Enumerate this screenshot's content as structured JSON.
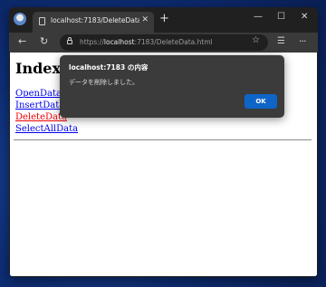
{
  "browser": {
    "tab_title": "localhost:7183/DeleteData.html",
    "url_prefix": "https://",
    "url_host": "localhost",
    "url_rest": ":7183/DeleteData.html"
  },
  "page": {
    "title": "Index",
    "links": [
      {
        "label": "OpenData"
      },
      {
        "label": "InsertData"
      },
      {
        "label": "DeleteData"
      },
      {
        "label": "SelectAllData"
      }
    ],
    "link_color": "#0000ee",
    "active_link_color": "#ee0000"
  },
  "dialog": {
    "title": "localhost:7183 の内容",
    "message": "データを削除しました。",
    "ok_label": "OK",
    "ok_color": "#0f64c8"
  }
}
